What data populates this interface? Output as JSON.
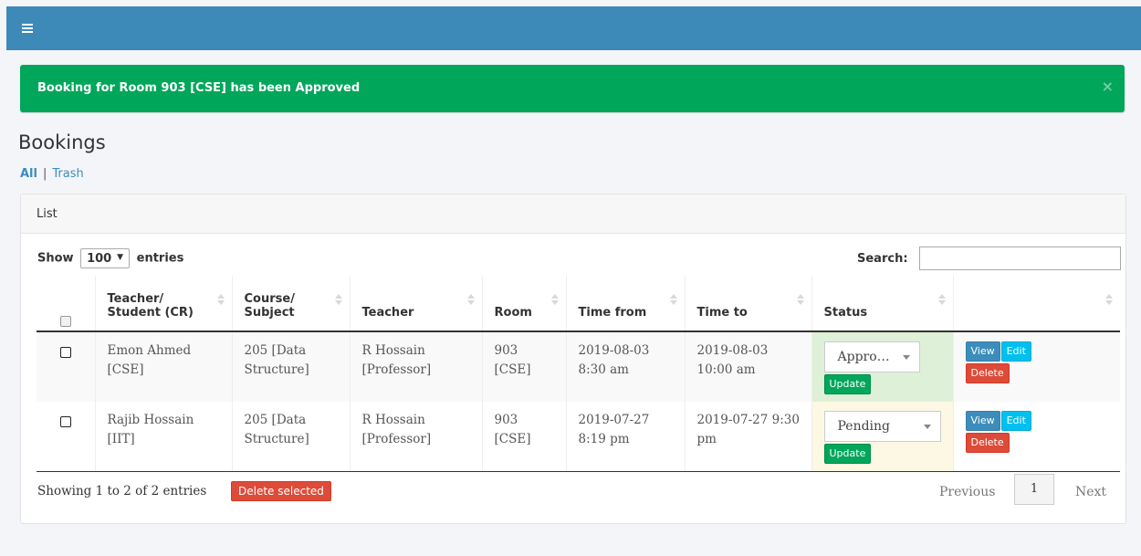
{
  "topbar": {
    "menu_icon": "hamburger-icon",
    "color": "#3d8ab9"
  },
  "alert": {
    "message": "Booking for Room 903 [CSE] has been Approved",
    "close": "×",
    "color": "#00a65a"
  },
  "page": {
    "title": "Bookings"
  },
  "subnav": {
    "all": "All",
    "separator": "|",
    "trash": "Trash"
  },
  "box": {
    "title": "List"
  },
  "table_controls": {
    "show_label": "Show",
    "length_value": "100",
    "length_caret": "▼",
    "entries_label": "entries",
    "search_label": "Search:",
    "search_value": ""
  },
  "table": {
    "columns": [
      "",
      "Teacher/ Student (CR)",
      "Course/ Subject",
      "Teacher",
      "Room",
      "Time from",
      "Time to",
      "Status",
      ""
    ],
    "rows": [
      {
        "student": "Emon Ahmed [CSE]",
        "course": "205 [Data Structure]",
        "teacher": "R Hossain [Professor]",
        "room": "903 [CSE]",
        "time_from": "2019-08-03 8:30 am",
        "time_to": "2019-08-03 10:00 am",
        "status": "Appro…",
        "status_state": "approved",
        "update": "Update",
        "view": "View",
        "edit": "Edit",
        "delete": "Delete"
      },
      {
        "student": "Rajib Hossain [IIT]",
        "course": "205 [Data Structure]",
        "teacher": "R Hossain [Professor]",
        "room": "903 [CSE]",
        "time_from": "2019-07-27 8:19 pm",
        "time_to": "2019-07-27 9:30 pm",
        "status": "Pending",
        "status_state": "pending",
        "update": "Update",
        "view": "View",
        "edit": "Edit",
        "delete": "Delete"
      }
    ]
  },
  "footer": {
    "info": "Showing 1 to 2 of 2 entries",
    "delete_selected": "Delete selected",
    "previous": "Previous",
    "page": "1",
    "next": "Next"
  }
}
